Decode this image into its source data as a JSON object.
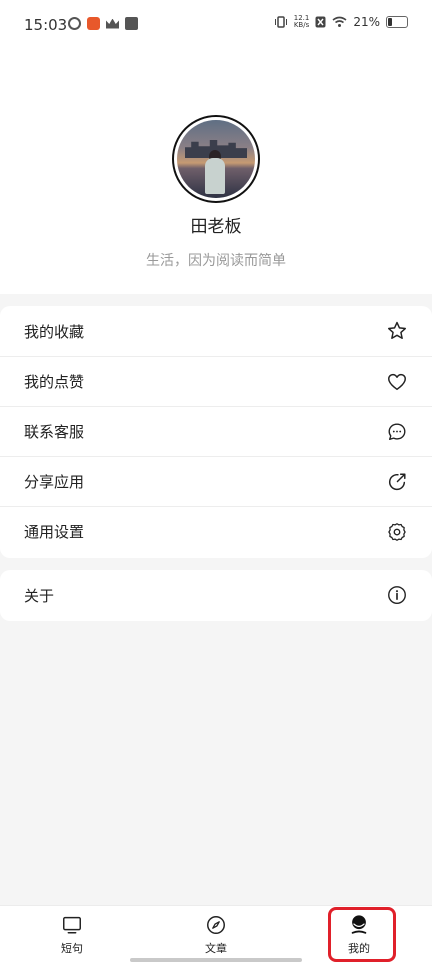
{
  "status_bar": {
    "time": "15:03",
    "speed_value": "12.1",
    "speed_unit": "KB/s",
    "battery_percent": "21%",
    "icons": [
      "moon-icon",
      "app-badge-icon",
      "crown-icon",
      "mail-icon",
      "vibrate-icon",
      "sim-icon",
      "wifi-icon",
      "battery-icon"
    ]
  },
  "profile": {
    "name": "田老板",
    "tagline": "生活，因为阅读而简单"
  },
  "menu": {
    "group1": [
      {
        "label": "我的收藏",
        "icon": "star-icon"
      },
      {
        "label": "我的点赞",
        "icon": "heart-icon"
      },
      {
        "label": "联系客服",
        "icon": "chat-icon"
      },
      {
        "label": "分享应用",
        "icon": "share-icon"
      },
      {
        "label": "通用设置",
        "icon": "settings-icon"
      }
    ],
    "group2": [
      {
        "label": "关于",
        "icon": "info-icon"
      }
    ]
  },
  "tabbar": {
    "tabs": [
      {
        "label": "短句",
        "icon": "monitor-icon"
      },
      {
        "label": "文章",
        "icon": "compass-icon"
      },
      {
        "label": "我的",
        "icon": "user-icon",
        "active": true
      }
    ]
  },
  "colors": {
    "highlight": "#e0202a",
    "background": "#f5f5f5"
  }
}
